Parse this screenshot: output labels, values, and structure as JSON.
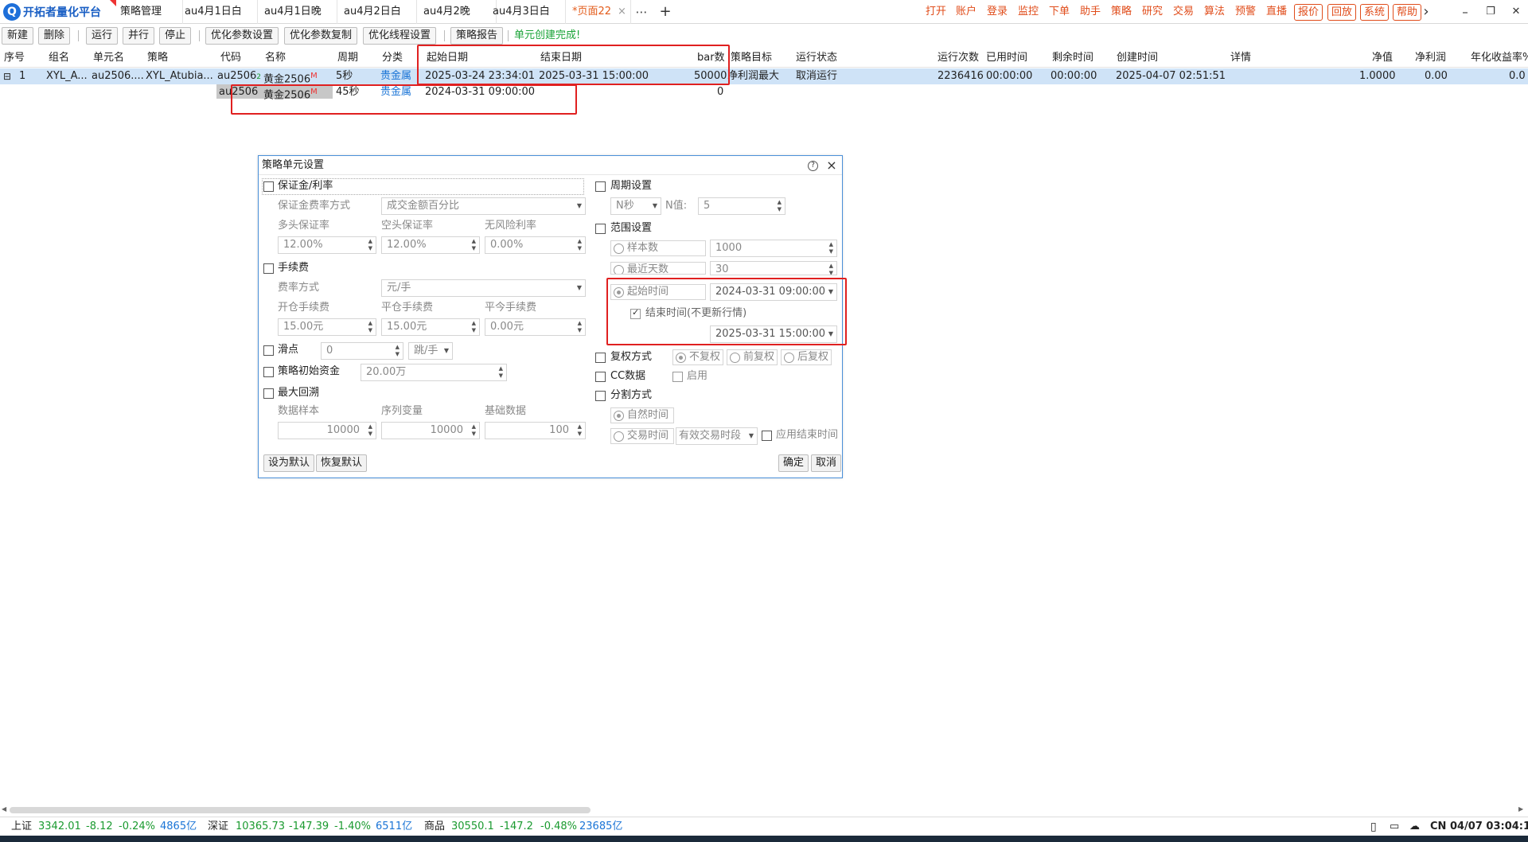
{
  "app": {
    "title": "开拓者量化平台"
  },
  "tabs": [
    {
      "label": "策略管理"
    },
    {
      "label": "au4月1日白"
    },
    {
      "label": "au4月1日晚"
    },
    {
      "label": "au4月2日白"
    },
    {
      "label": "au4月2晚"
    },
    {
      "label": "au4月3日白"
    },
    {
      "label": "*页面22",
      "close": "×"
    }
  ],
  "tab_more": "⋯",
  "tab_add": "+",
  "nav": {
    "links": [
      "打开",
      "账户",
      "登录",
      "监控",
      "下单",
      "助手",
      "策略",
      "研究",
      "交易",
      "算法",
      "预警",
      "直播"
    ],
    "boxed": [
      "报价",
      "回放",
      "系统",
      "帮助"
    ],
    "chevron": "›"
  },
  "window": {
    "min": "–",
    "restore": "❐",
    "close": "✕"
  },
  "toolbar": {
    "buttons": [
      "新建",
      "删除",
      "运行",
      "并行",
      "停止",
      "优化参数设置",
      "优化参数复制",
      "优化线程设置",
      "策略报告"
    ],
    "status": "单元创建完成!"
  },
  "grid": {
    "headers": [
      "序号",
      "组名",
      "单元名",
      "策略",
      "代码",
      "名称",
      "周期",
      "分类",
      "起始日期",
      "结束日期",
      "bar数",
      "策略目标",
      "运行状态",
      "运行次数",
      "已用时间",
      "剩余时间",
      "创建时间",
      "详情",
      "净值",
      "净利润",
      "年化收益率%"
    ],
    "row": {
      "expand": "⊟",
      "seq": "1",
      "group": "XYL_A...",
      "unit": "au2506....",
      "strategy": "XYL_Atubia...",
      "code": "au2506",
      "code_idx": "2",
      "name": "黄金2506",
      "name_mark": "M",
      "period": "5秒",
      "category": "贵金属",
      "start": "2025-03-24 23:34:01",
      "end": "2025-03-31 15:00:00",
      "bars": "50000",
      "target": "净利润最大",
      "status": "取消运行",
      "runs": "2236416",
      "used": "00:00:00",
      "remain": "00:00:00",
      "created": "2025-04-07 02:51:51",
      "detail": "",
      "nav": "1.0000",
      "profit": "0.00",
      "annual": "0.0"
    },
    "subrow": {
      "code": "au2506",
      "name": "黄金2506",
      "name_mark": "M",
      "period": "45秒",
      "category": "贵金属",
      "start": "2024-03-31 09:00:00",
      "bars": "0"
    }
  },
  "dialog": {
    "title": "策略单元设置",
    "help_icon": "?",
    "close_icon": "×",
    "margin": {
      "label": "保证金/利率",
      "mode_label": "保证金费率方式",
      "mode_value": "成交金额百分比",
      "long_label": "多头保证率",
      "long_value": "12.00%",
      "short_label": "空头保证率",
      "short_value": "12.00%",
      "rf_label": "无风险利率",
      "rf_value": "0.00%"
    },
    "fee": {
      "label": "手续费",
      "mode_label": "费率方式",
      "mode_value": "元/手",
      "open_label": "开仓手续费",
      "open_value": "15.00元",
      "close_label": "平仓手续费",
      "close_value": "15.00元",
      "today_label": "平今手续费",
      "today_value": "0.00元"
    },
    "slip": {
      "label": "滑点",
      "value": "0",
      "unit": "跳/手"
    },
    "capital": {
      "label": "策略初始资金",
      "value": "20.00万"
    },
    "lookback": {
      "label": "最大回溯",
      "sample_label": "数据样本",
      "sample_value": "10000",
      "series_label": "序列变量",
      "series_value": "10000",
      "base_label": "基础数据",
      "base_value": "100"
    },
    "period": {
      "label": "周期设置",
      "unit": "N秒",
      "n_label": "N值:",
      "n_value": "5"
    },
    "range": {
      "label": "范围设置",
      "samples_label": "样本数",
      "samples_value": "1000",
      "days_label": "最近天数",
      "days_value": "30",
      "start_label": "起始时间",
      "start_value": "2024-03-31 09:00:00",
      "end_label": "结束时间(不更新行情)",
      "end_value": "2025-03-31 15:00:00"
    },
    "adjust": {
      "label": "复权方式",
      "none": "不复权",
      "fwd": "前复权",
      "back": "后复权"
    },
    "cc": {
      "label": "CC数据",
      "enable": "启用"
    },
    "split": {
      "label": "分割方式",
      "natural": "自然时间",
      "trade": "交易时间",
      "trade_value": "有效交易时段",
      "apply_end": "应用结束时间"
    },
    "buttons": {
      "set_default": "设为默认",
      "restore_default": "恢复默认",
      "ok": "确定",
      "cancel": "取消"
    }
  },
  "statusbar": {
    "sh_label": "上证",
    "sh_value": "3342.01",
    "sh_change": "-8.12",
    "sh_pct": "-0.24%",
    "sh_vol": "4865亿",
    "sz_label": "深证",
    "sz_value": "10365.73",
    "sz_change": "-147.39",
    "sz_pct": "-1.40%",
    "sz_vol": "6511亿",
    "cm_label": "商品",
    "cm_value": "30550.1",
    "cm_change": "-147.2",
    "cm_pct": "-0.48%",
    "cm_vol": "23685亿",
    "clock": "CN 04/07 03:04:15"
  },
  "colors": {
    "accent": "#e04c1a",
    "link": "#1a74d6",
    "up": "#1a9a2f",
    "highlight": "#e02020",
    "selected_row": "#cfe3f7"
  }
}
